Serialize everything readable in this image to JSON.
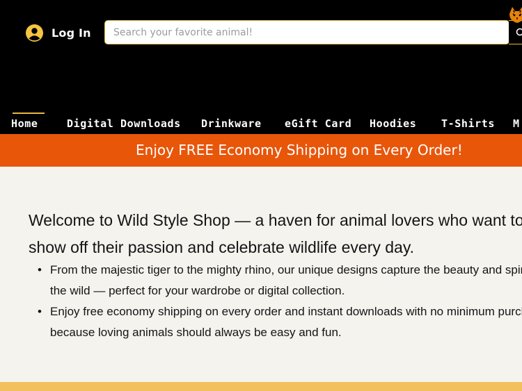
{
  "header": {
    "login_label": "Log In",
    "search_placeholder": "Search your favorite animal!",
    "logo_icon": "tiger-logo-icon"
  },
  "nav": {
    "items": [
      "Home",
      "Digital Downloads",
      "Drinkware",
      "eGift Card",
      "Hoodies",
      "T-Shirts",
      "M"
    ],
    "active": "Home"
  },
  "promo": {
    "text": "Enjoy FREE Economy Shipping on Every Order!"
  },
  "main": {
    "intro": "Welcome to Wild Style Shop — a haven for animal lovers who want to show off their passion and celebrate wildlife every day.",
    "bullets": [
      "From the majestic tiger to the mighty rhino, our unique designs capture the beauty and spirit of the wild — perfect for your wardrobe or digital collection.",
      "Enjoy free economy shipping on every order and instant downloads with no minimum purchase, because loving animals should always be easy and fun."
    ]
  },
  "colors": {
    "header_bg": "#000000",
    "accent_orange": "#e8560a",
    "accent_gold": "#e8b83a",
    "page_bg": "#f5f3ee",
    "footer_band": "#f2c15e"
  }
}
